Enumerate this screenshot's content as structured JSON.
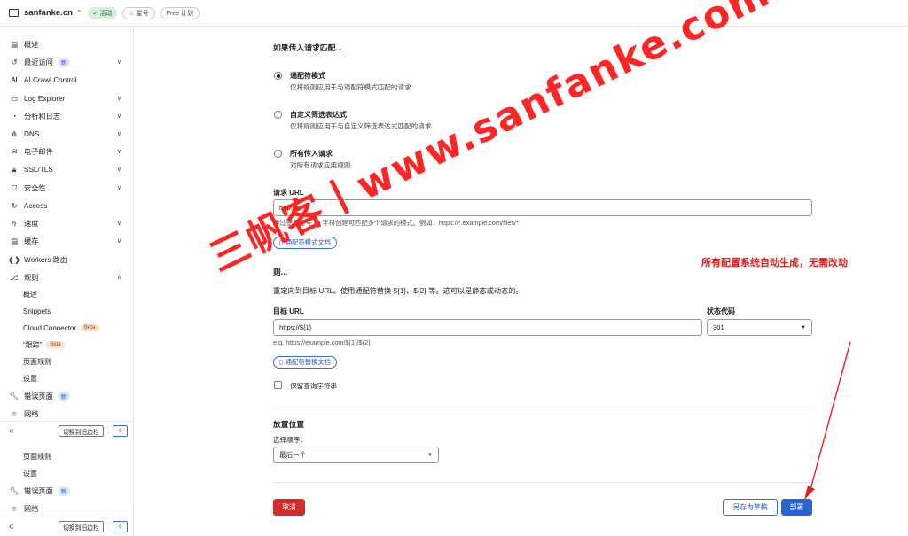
{
  "topbar": {
    "site_name": "sanfanke.cn",
    "status": "✓ 活动",
    "star": "☆ 星号",
    "plan": "Free 计划"
  },
  "sidebar": {
    "items": [
      {
        "label": "概述"
      },
      {
        "label": "最近访问",
        "badge": "新"
      },
      {
        "label": "AI Crawl Control"
      },
      {
        "label": "Log Explorer"
      },
      {
        "label": "分析和日志"
      },
      {
        "label": "DNS"
      },
      {
        "label": "电子邮件"
      },
      {
        "label": "SSL/TLS"
      },
      {
        "label": "安全性"
      },
      {
        "label": "Access"
      },
      {
        "label": "速度"
      },
      {
        "label": "缓存"
      },
      {
        "label": "Workers 路由"
      },
      {
        "label": "规则"
      }
    ],
    "rules_sub": [
      {
        "label": "概述"
      },
      {
        "label": "Snippets"
      },
      {
        "label": "Cloud Connector",
        "badge": "Beta"
      },
      {
        "label": "“跟踪”",
        "badge": "Beta"
      },
      {
        "label": "页面规则"
      },
      {
        "label": "设置"
      }
    ],
    "error_pages": {
      "label": "错误页面",
      "badge": "新"
    },
    "network": {
      "label": "网络"
    },
    "switch_label": "切换到旧边栏",
    "overlap_sub": [
      {
        "label": "页面规则"
      },
      {
        "label": "设置"
      }
    ],
    "error_pages_2": {
      "label": "错误页面",
      "badge": "新"
    },
    "network_2": {
      "label": "网络"
    }
  },
  "form": {
    "match_title": "如果传入请求匹配...",
    "options": [
      {
        "title": "通配符模式",
        "desc": "仅将规则应用于与通配符模式匹配的请求",
        "checked": true
      },
      {
        "title": "自定义筛选表达式",
        "desc": "仅将规则应用于与自定义筛选表达式匹配的请求",
        "checked": false
      },
      {
        "title": "所有传入请求",
        "desc": "对所有请求应用规则",
        "checked": false
      }
    ],
    "url_label": "请求 URL",
    "url_value": "http://*",
    "url_hint": "通过使用星号 (*) 字符创建可匹配多个请求的模式。例如，https://*.example.com/files/*",
    "wildcard_doc": "通配符模式文档",
    "then_title": "则...",
    "then_desc": "重定向到目标 URL。使用通配符替换 ${1}、${2} 等。这可以是静态或动态的。",
    "target_label": "目标 URL",
    "target_value": "https://${1}",
    "target_hint": "e.g. https://example.com/${1}/${2}",
    "status_label": "状态代码",
    "status_value": "301",
    "replace_doc": "通配符替换文档",
    "preserve_query": "保留查询字符串",
    "placement_title": "放置位置",
    "order_label": "选择顺序：",
    "order_value": "最后一个",
    "cancel": "取消",
    "save_draft": "另存为草稿",
    "deploy": "部署"
  },
  "annotation": "所有配置系统自动生成，无需改动",
  "watermark": "三帆客丨www.sanfanke.com"
}
